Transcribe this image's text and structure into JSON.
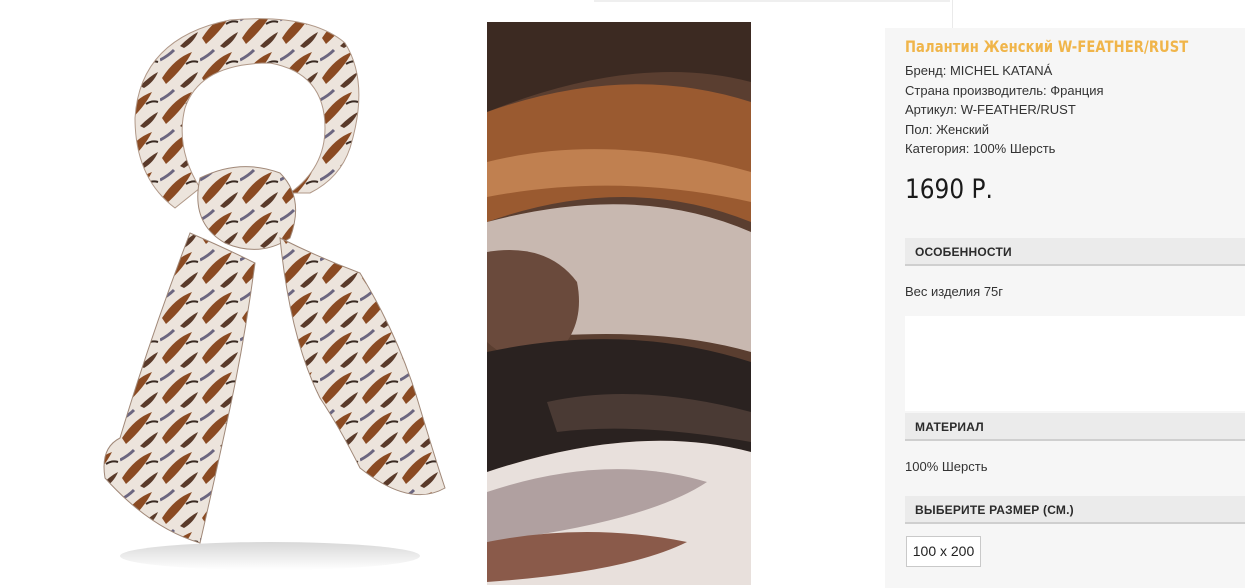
{
  "product": {
    "title": "Палантин Женский W-FEATHER/RUST",
    "brand": "Бренд: MICHEL KATANÁ",
    "country": "Страна производитель: Франция",
    "article": "Артикул: W-FEATHER/RUST",
    "gender": "Пол: Женский",
    "category": "Категория: 100% Шерсть",
    "price": "1690 Р."
  },
  "sections": {
    "features": {
      "heading": "ОСОБЕННОСТИ",
      "text": "Вес изделия 75г"
    },
    "material": {
      "heading": "МАТЕРИАЛ",
      "text": "100% Шерсть"
    },
    "size": {
      "heading": "ВЫБЕРИТЕ РАЗМЕР (СМ.)",
      "options": [
        "100 x 200"
      ]
    }
  },
  "colors": {
    "title_accent": "#f0b54a",
    "panel_bg": "#f6f6f6",
    "section_bg": "#ebebeb",
    "scarf_rust": "#8a4a22",
    "scarf_cream": "#ece4dc"
  },
  "images": {
    "main": "scarf-product-photo",
    "zoom": "scarf-fabric-closeup"
  }
}
